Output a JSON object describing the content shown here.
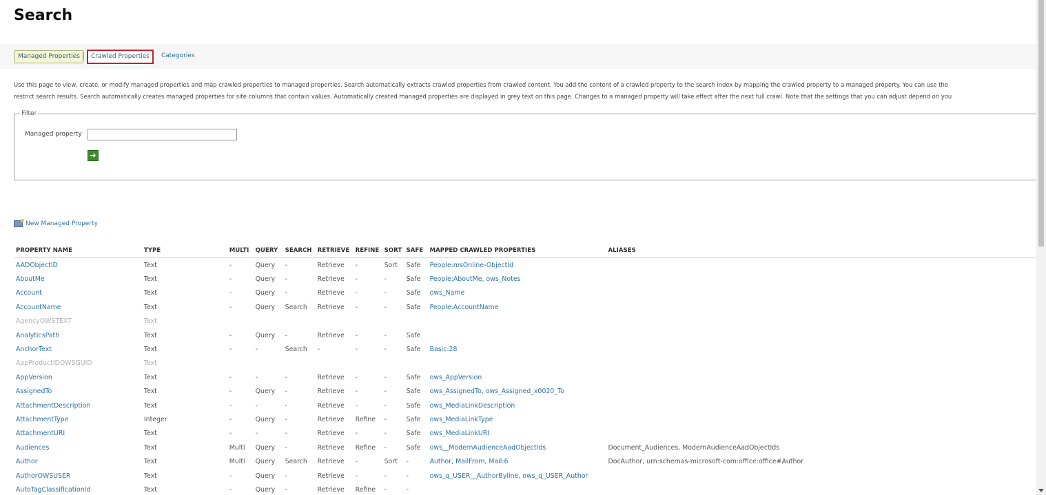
{
  "title": "Search",
  "tabs": {
    "managed": "Managed Properties",
    "crawled": "Crawled Properties",
    "categories": "Categories"
  },
  "description": {
    "line1": "Use this page to view, create, or modify managed properties and map crawled properties to managed properties. Search automatically extracts crawled properties from crawled content. You add the content of a crawled property to the search index by mapping the crawled property to a managed property. You can use the",
    "line2": "restrict search results. Search automatically creates managed properties for site columns that contain values. Automatically created managed properties are displayed in grey text on this page. Changes to a managed property will take effect after the next full crawl. Note that the settings that you can adjust depend on you"
  },
  "filter": {
    "legend": "Filter",
    "label": "Managed property",
    "value": "",
    "go_glyph": "➔"
  },
  "new_property": "New Managed Property",
  "table": {
    "headers": [
      "PROPERTY NAME",
      "TYPE",
      "MULTI",
      "QUERY",
      "SEARCH",
      "RETRIEVE",
      "REFINE",
      "SORT",
      "SAFE",
      "MAPPED CRAWLED PROPERTIES",
      "ALIASES"
    ],
    "rows": [
      {
        "name": "AADObjectID",
        "type": "Text",
        "multi": "-",
        "query": "Query",
        "search": "-",
        "retrieve": "Retrieve",
        "refine": "-",
        "sort": "Sort",
        "safe": "Safe",
        "mapped": "People:msOnline-ObjectId",
        "aliases": "",
        "grey": false
      },
      {
        "name": "AboutMe",
        "type": "Text",
        "multi": "-",
        "query": "Query",
        "search": "-",
        "retrieve": "Retrieve",
        "refine": "-",
        "sort": "-",
        "safe": "Safe",
        "mapped": "People:AboutMe, ows_Notes",
        "aliases": "",
        "grey": false
      },
      {
        "name": "Account",
        "type": "Text",
        "multi": "-",
        "query": "Query",
        "search": "-",
        "retrieve": "Retrieve",
        "refine": "-",
        "sort": "-",
        "safe": "Safe",
        "mapped": "ows_Name",
        "aliases": "",
        "grey": false
      },
      {
        "name": "AccountName",
        "type": "Text",
        "multi": "-",
        "query": "Query",
        "search": "Search",
        "retrieve": "Retrieve",
        "refine": "-",
        "sort": "-",
        "safe": "Safe",
        "mapped": "People:AccountName",
        "aliases": "",
        "grey": false
      },
      {
        "name": "AgencyOWSTEXT",
        "type": "Text",
        "multi": "",
        "query": "",
        "search": "",
        "retrieve": "",
        "refine": "",
        "sort": "",
        "safe": "",
        "mapped": "",
        "aliases": "",
        "grey": true
      },
      {
        "name": "AnalyticsPath",
        "type": "Text",
        "multi": "-",
        "query": "Query",
        "search": "-",
        "retrieve": "Retrieve",
        "refine": "-",
        "sort": "-",
        "safe": "Safe",
        "mapped": "",
        "aliases": "",
        "grey": false
      },
      {
        "name": "AnchorText",
        "type": "Text",
        "multi": "-",
        "query": "-",
        "search": "Search",
        "retrieve": "-",
        "refine": "-",
        "sort": "-",
        "safe": "Safe",
        "mapped": "Basic:28",
        "aliases": "",
        "grey": false
      },
      {
        "name": "AppProductIDOWSGUID",
        "type": "Text",
        "multi": "",
        "query": "",
        "search": "",
        "retrieve": "",
        "refine": "",
        "sort": "",
        "safe": "",
        "mapped": "",
        "aliases": "",
        "grey": true
      },
      {
        "name": "AppVersion",
        "type": "Text",
        "multi": "-",
        "query": "-",
        "search": "-",
        "retrieve": "Retrieve",
        "refine": "-",
        "sort": "-",
        "safe": "Safe",
        "mapped": "ows_AppVersion",
        "aliases": "",
        "grey": false
      },
      {
        "name": "AssignedTo",
        "type": "Text",
        "multi": "-",
        "query": "Query",
        "search": "-",
        "retrieve": "Retrieve",
        "refine": "-",
        "sort": "-",
        "safe": "Safe",
        "mapped": "ows_AssignedTo, ows_Assigned_x0020_To",
        "aliases": "",
        "grey": false
      },
      {
        "name": "AttachmentDescription",
        "type": "Text",
        "multi": "-",
        "query": "-",
        "search": "-",
        "retrieve": "Retrieve",
        "refine": "-",
        "sort": "-",
        "safe": "Safe",
        "mapped": "ows_MediaLinkDescription",
        "aliases": "",
        "grey": false
      },
      {
        "name": "AttachmentType",
        "type": "Integer",
        "multi": "-",
        "query": "Query",
        "search": "-",
        "retrieve": "Retrieve",
        "refine": "Refine",
        "sort": "-",
        "safe": "Safe",
        "mapped": "ows_MediaLinkType",
        "aliases": "",
        "grey": false
      },
      {
        "name": "AttachmentURI",
        "type": "Text",
        "multi": "-",
        "query": "-",
        "search": "-",
        "retrieve": "Retrieve",
        "refine": "-",
        "sort": "-",
        "safe": "Safe",
        "mapped": "ows_MediaLinkURI",
        "aliases": "",
        "grey": false
      },
      {
        "name": "Audiences",
        "type": "Text",
        "multi": "Multi",
        "query": "Query",
        "search": "-",
        "retrieve": "Retrieve",
        "refine": "Refine",
        "sort": "-",
        "safe": "Safe",
        "mapped": "ows__ModernAudienceAadObjectIds",
        "aliases": "Document_Audiences, ModernAudienceAadObjectIds",
        "grey": false
      },
      {
        "name": "Author",
        "type": "Text",
        "multi": "Multi",
        "query": "Query",
        "search": "Search",
        "retrieve": "Retrieve",
        "refine": "-",
        "sort": "Sort",
        "safe": "-",
        "mapped": "Author, MailFrom, Mail:6",
        "aliases": "DocAuthor, urn:schemas-microsoft-com:office:office#Author",
        "grey": false
      },
      {
        "name": "AuthorOWSUSER",
        "type": "Text",
        "multi": "-",
        "query": "Query",
        "search": "-",
        "retrieve": "Retrieve",
        "refine": "-",
        "sort": "-",
        "safe": "-",
        "mapped": "ows_q_USER__AuthorByline, ows_q_USER_Author",
        "aliases": "",
        "grey": false
      },
      {
        "name": "AutoTagClassificationId",
        "type": "Text",
        "multi": "-",
        "query": "Query",
        "search": "-",
        "retrieve": "Retrieve",
        "refine": "Refine",
        "sort": "-",
        "safe": "-",
        "mapped": "",
        "aliases": "",
        "grey": false
      }
    ]
  }
}
